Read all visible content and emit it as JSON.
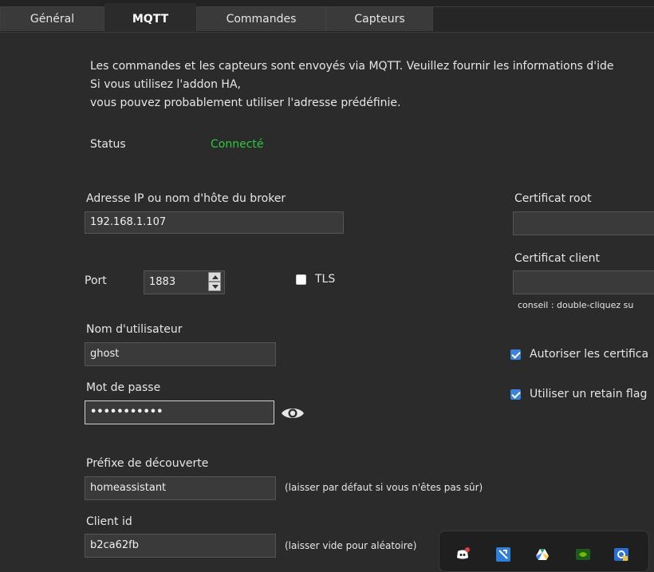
{
  "tabs": [
    {
      "label": "Général",
      "active": false
    },
    {
      "label": "MQTT",
      "active": true
    },
    {
      "label": "Commandes",
      "active": false
    },
    {
      "label": "Capteurs",
      "active": false
    }
  ],
  "intro": {
    "line1": "Les commandes et les capteurs sont envoyés via MQTT. Veuillez fournir les informations d'ide",
    "line2": "Si vous utilisez l'addon HA,",
    "line3": "vous pouvez probablement utiliser l'adresse prédéfinie."
  },
  "status": {
    "label": "Status",
    "value": "Connecté",
    "value_color": "#2ac93d"
  },
  "broker": {
    "label": "Adresse IP ou nom d'hôte du broker",
    "value": "192.168.1.107"
  },
  "port": {
    "label": "Port",
    "value": "1883"
  },
  "tls": {
    "label": "TLS",
    "checked": false
  },
  "username": {
    "label": "Nom d'utilisateur",
    "value": "ghost"
  },
  "password": {
    "label": "Mot de passe",
    "value": "•••••••••••",
    "reveal_icon": "eye-icon"
  },
  "discovery": {
    "label": "Préfixe de découverte",
    "value": "homeassistant",
    "hint": "(laisser par défaut si vous n'êtes pas sûr)"
  },
  "client_id": {
    "label": "Client id",
    "value": "b2ca62fb",
    "hint": "(laisser vide pour aléatoire)"
  },
  "root_cert": {
    "label": "Certificat root",
    "value": ""
  },
  "client_cert": {
    "label": "Certificat client",
    "value": "",
    "hint": "conseil : double-cliquez su"
  },
  "allow_certs": {
    "label": "Autoriser les certifica",
    "checked": true
  },
  "retain_flag": {
    "label": "Utiliser un retain flag",
    "checked": true
  },
  "tray": {
    "icons": [
      "discord-icon",
      "network-tool-icon",
      "google-drive-icon",
      "nvidia-icon",
      "settings-app-icon"
    ]
  },
  "colors": {
    "accent": "#3a83d8",
    "background": "#2b2b2b",
    "input_bg": "#3a3a3a",
    "connected": "#2ac93d"
  }
}
